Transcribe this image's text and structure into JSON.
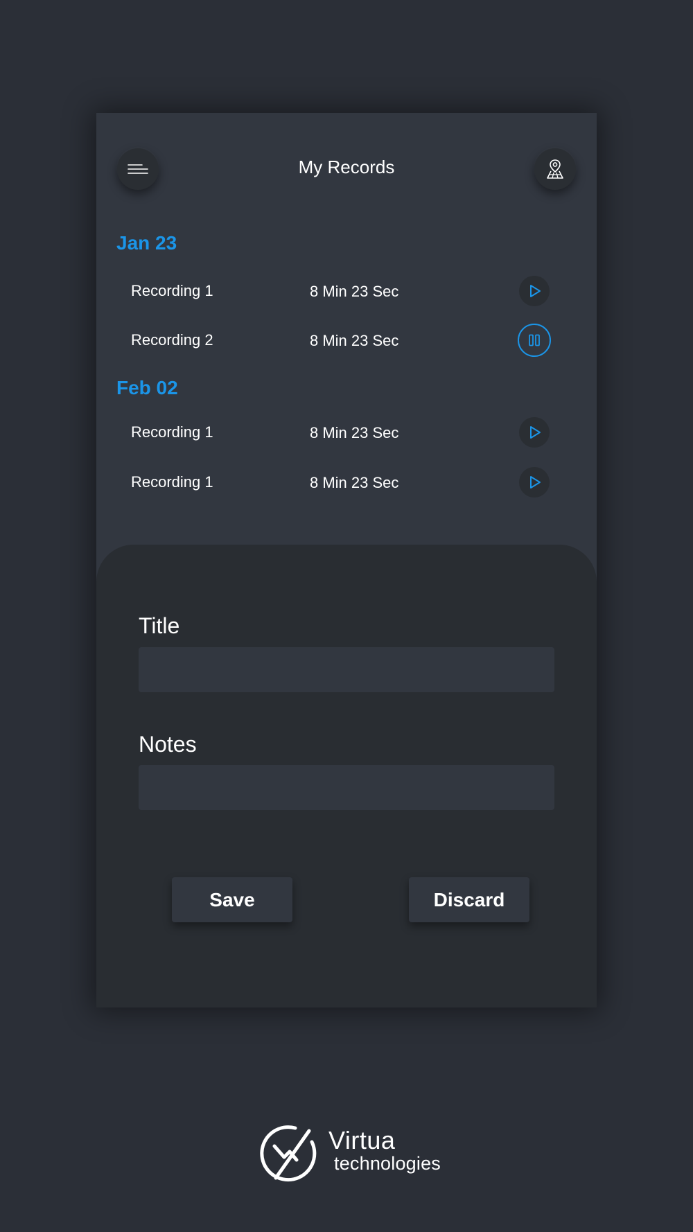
{
  "header": {
    "title": "My Records",
    "menu_icon": "hamburger-menu-icon",
    "map_icon": "map-pin-icon"
  },
  "groups": [
    {
      "date": "Jan 23",
      "recordings": [
        {
          "name": "Recording 1",
          "duration": "8 Min 23 Sec",
          "state": "play"
        },
        {
          "name": "Recording 2",
          "duration": "8 Min 23 Sec",
          "state": "pause"
        }
      ]
    },
    {
      "date": "Feb 02",
      "recordings": [
        {
          "name": "Recording 1",
          "duration": "8 Min 23 Sec",
          "state": "play"
        },
        {
          "name": "Recording 1",
          "duration": "8 Min 23 Sec",
          "state": "play"
        }
      ]
    }
  ],
  "form": {
    "title_label": "Title",
    "title_value": "",
    "notes_label": "Notes",
    "notes_value": "",
    "save_label": "Save",
    "discard_label": "Discard"
  },
  "brand": {
    "name": "Virtua",
    "tagline": "technologies"
  },
  "colors": {
    "background": "#2b2f37",
    "panel": "#323740",
    "sheet": "#292d32",
    "accent": "#1b95e8",
    "text": "#ffffff"
  }
}
